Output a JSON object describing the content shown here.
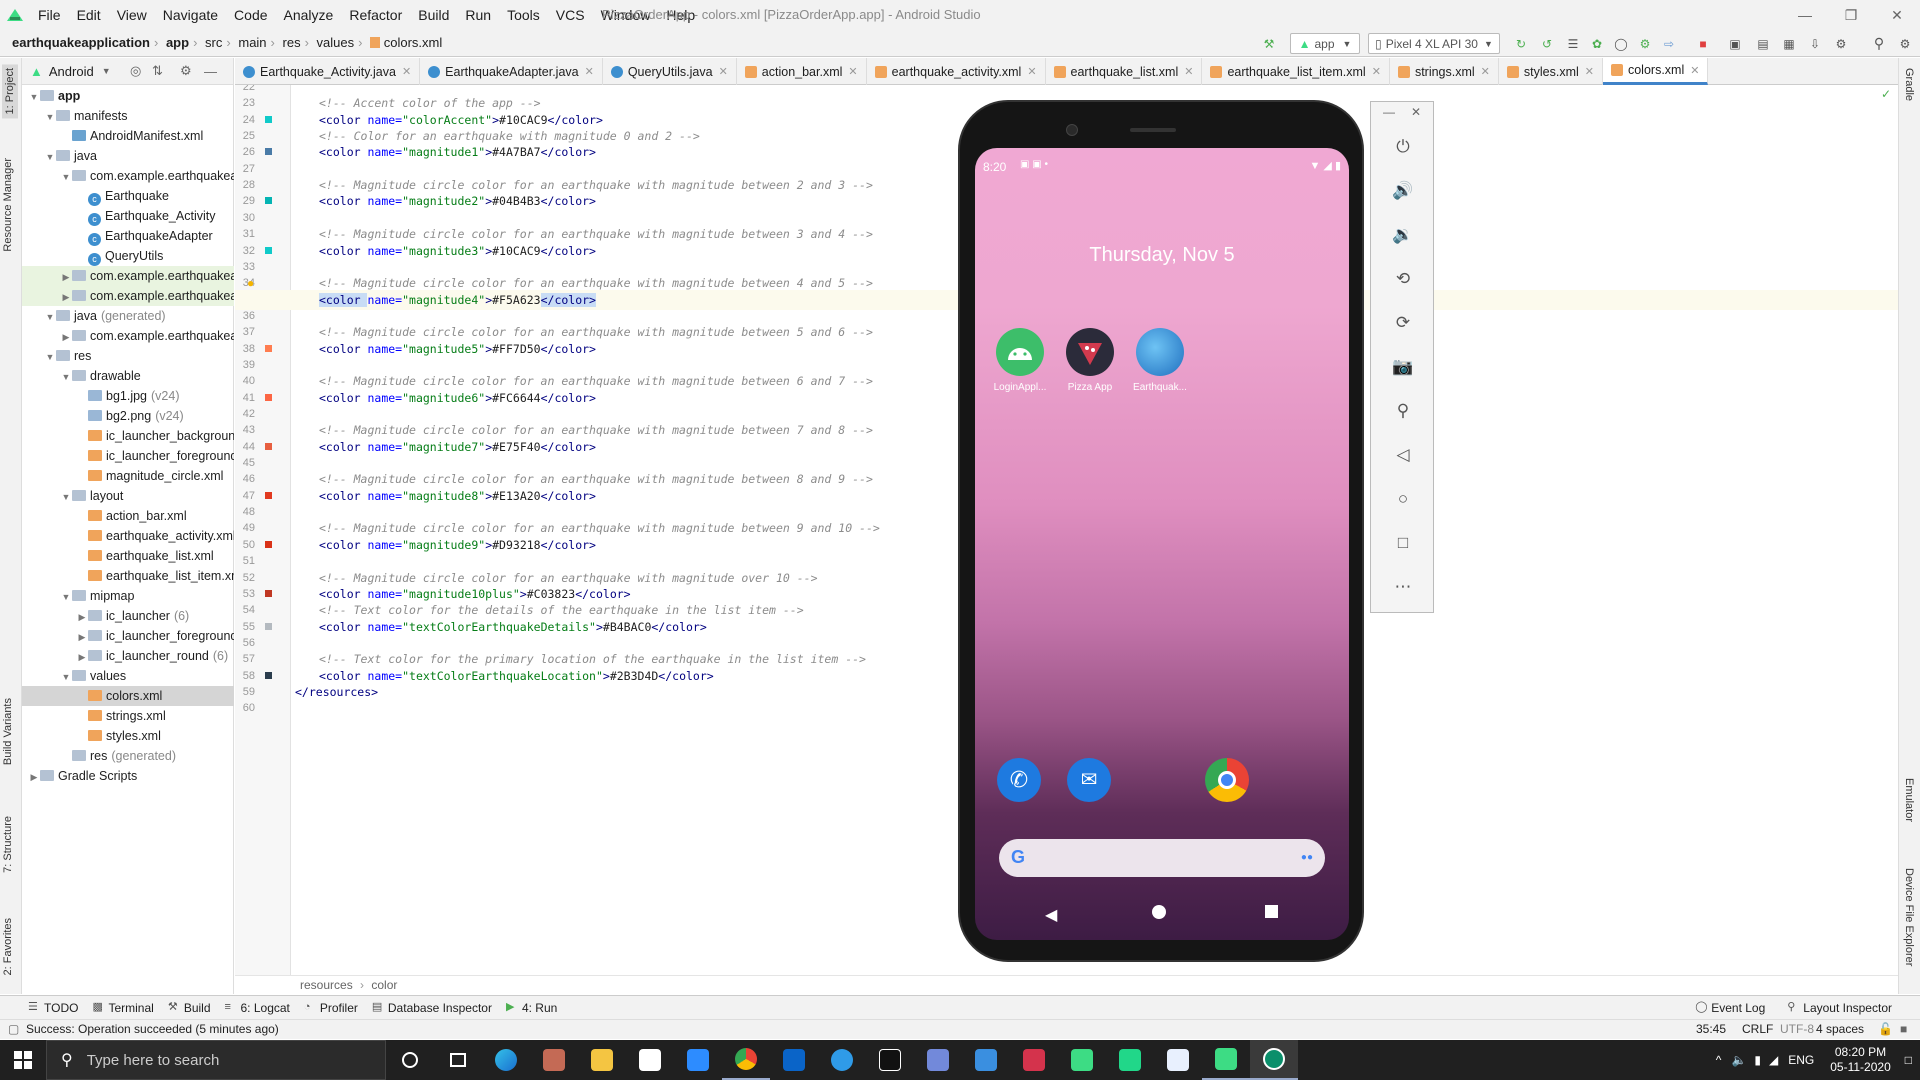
{
  "menubar": {
    "items": [
      "File",
      "Edit",
      "View",
      "Navigate",
      "Code",
      "Analyze",
      "Refactor",
      "Build",
      "Run",
      "Tools",
      "VCS",
      "Window",
      "Help"
    ],
    "window_title": "PizzaOrderApp - colors.xml [PizzaOrderApp.app] - Android Studio"
  },
  "navbar": {
    "breadcrumb": [
      "earthquakeapplication",
      "app",
      "src",
      "main",
      "res",
      "values",
      "colors.xml"
    ],
    "run_config": "app",
    "device": "Pixel 4 XL API 30"
  },
  "project": {
    "view_mode": "Android",
    "tree": [
      {
        "label": "app",
        "indent": 0,
        "arrow": "▼",
        "icon": "fold",
        "bold": true
      },
      {
        "label": "manifests",
        "indent": 1,
        "arrow": "▼",
        "icon": "fold"
      },
      {
        "label": "AndroidManifest.xml",
        "indent": 2,
        "arrow": "",
        "icon": "man"
      },
      {
        "label": "java",
        "indent": 1,
        "arrow": "▼",
        "icon": "fold"
      },
      {
        "label": "com.example.earthquakeapplication",
        "indent": 2,
        "arrow": "▼",
        "icon": "fold"
      },
      {
        "label": "Earthquake",
        "indent": 3,
        "arrow": "",
        "icon": "cls"
      },
      {
        "label": "Earthquake_Activity",
        "indent": 3,
        "arrow": "",
        "icon": "cls"
      },
      {
        "label": "EarthquakeAdapter",
        "indent": 3,
        "arrow": "",
        "icon": "cls"
      },
      {
        "label": "QueryUtils",
        "indent": 3,
        "arrow": "",
        "icon": "cls"
      },
      {
        "label": "com.example.earthquakeapplication",
        "indent": 2,
        "arrow": "▶",
        "icon": "fold",
        "hl": true
      },
      {
        "label": "com.example.earthquakeapplication",
        "indent": 2,
        "arrow": "▶",
        "icon": "fold",
        "hl": true
      },
      {
        "label": "java",
        "extra": "(generated)",
        "indent": 1,
        "arrow": "▼",
        "icon": "fold"
      },
      {
        "label": "com.example.earthquakeapplication",
        "indent": 2,
        "arrow": "▶",
        "icon": "fold"
      },
      {
        "label": "res",
        "indent": 1,
        "arrow": "▼",
        "icon": "fold"
      },
      {
        "label": "drawable",
        "indent": 2,
        "arrow": "▼",
        "icon": "fold"
      },
      {
        "label": "bg1.jpg",
        "extra": "(v24)",
        "indent": 3,
        "arrow": "",
        "icon": "img"
      },
      {
        "label": "bg2.png",
        "extra": "(v24)",
        "indent": 3,
        "arrow": "",
        "icon": "img"
      },
      {
        "label": "ic_launcher_background.xml",
        "indent": 3,
        "arrow": "",
        "icon": "xml"
      },
      {
        "label": "ic_launcher_foreground.xml",
        "indent": 3,
        "arrow": "",
        "icon": "xml"
      },
      {
        "label": "magnitude_circle.xml",
        "indent": 3,
        "arrow": "",
        "icon": "xml"
      },
      {
        "label": "layout",
        "indent": 2,
        "arrow": "▼",
        "icon": "fold"
      },
      {
        "label": "action_bar.xml",
        "indent": 3,
        "arrow": "",
        "icon": "xml"
      },
      {
        "label": "earthquake_activity.xml",
        "indent": 3,
        "arrow": "",
        "icon": "xml"
      },
      {
        "label": "earthquake_list.xml",
        "indent": 3,
        "arrow": "",
        "icon": "xml"
      },
      {
        "label": "earthquake_list_item.xml",
        "indent": 3,
        "arrow": "",
        "icon": "xml"
      },
      {
        "label": "mipmap",
        "indent": 2,
        "arrow": "▼",
        "icon": "fold"
      },
      {
        "label": "ic_launcher",
        "extra": "(6)",
        "indent": 3,
        "arrow": "▶",
        "icon": "fold"
      },
      {
        "label": "ic_launcher_foreground",
        "extra": "(6)",
        "indent": 3,
        "arrow": "▶",
        "icon": "fold"
      },
      {
        "label": "ic_launcher_round",
        "extra": "(6)",
        "indent": 3,
        "arrow": "▶",
        "icon": "fold"
      },
      {
        "label": "values",
        "indent": 2,
        "arrow": "▼",
        "icon": "fold"
      },
      {
        "label": "colors.xml",
        "indent": 3,
        "arrow": "",
        "icon": "xml",
        "selected": true
      },
      {
        "label": "strings.xml",
        "indent": 3,
        "arrow": "",
        "icon": "xml"
      },
      {
        "label": "styles.xml",
        "indent": 3,
        "arrow": "",
        "icon": "xml"
      },
      {
        "label": "res",
        "extra": "(generated)",
        "indent": 2,
        "arrow": "",
        "icon": "fold"
      },
      {
        "label": "Gradle Scripts",
        "indent": 0,
        "arrow": "▶",
        "icon": "fold"
      }
    ]
  },
  "tabs": [
    {
      "label": "Earthquake_Activity.java",
      "icon": "cls"
    },
    {
      "label": "EarthquakeAdapter.java",
      "icon": "cls"
    },
    {
      "label": "QueryUtils.java",
      "icon": "cls"
    },
    {
      "label": "action_bar.xml",
      "icon": "xml"
    },
    {
      "label": "earthquake_activity.xml",
      "icon": "xml"
    },
    {
      "label": "earthquake_list.xml",
      "icon": "xml"
    },
    {
      "label": "earthquake_list_item.xml",
      "icon": "xml"
    },
    {
      "label": "strings.xml",
      "icon": "xml"
    },
    {
      "label": "styles.xml",
      "icon": "xml"
    },
    {
      "label": "colors.xml",
      "icon": "xml",
      "active": true
    }
  ],
  "editor": {
    "lines": [
      {
        "n": 22,
        "parts": []
      },
      {
        "n": 23,
        "parts": [
          [
            "cm",
            "<!-- Accent color of the app -->"
          ]
        ]
      },
      {
        "n": 24,
        "swatch": "#10CAC9",
        "parts": [
          [
            "tg",
            "<color "
          ],
          [
            "an",
            "name="
          ],
          [
            "av",
            "\"colorAccent\""
          ],
          [
            "tg",
            ">"
          ],
          [
            "tx",
            "#10CAC9"
          ],
          [
            "tg",
            "</color>"
          ]
        ]
      },
      {
        "n": 25,
        "parts": [
          [
            "cm",
            "<!-- Color for an earthquake with magnitude 0 and 2 -->"
          ]
        ]
      },
      {
        "n": 26,
        "swatch": "#4A7BA7",
        "parts": [
          [
            "tg",
            "<color "
          ],
          [
            "an",
            "name="
          ],
          [
            "av",
            "\"magnitude1\""
          ],
          [
            "tg",
            ">"
          ],
          [
            "tx",
            "#4A7BA7"
          ],
          [
            "tg",
            "</color>"
          ]
        ]
      },
      {
        "n": 27,
        "parts": []
      },
      {
        "n": 28,
        "parts": [
          [
            "cm",
            "<!-- Magnitude circle color for an earthquake with magnitude between 2 and 3 -->"
          ]
        ]
      },
      {
        "n": 29,
        "swatch": "#04B4B3",
        "parts": [
          [
            "tg",
            "<color "
          ],
          [
            "an",
            "name="
          ],
          [
            "av",
            "\"magnitude2\""
          ],
          [
            "tg",
            ">"
          ],
          [
            "tx",
            "#04B4B3"
          ],
          [
            "tg",
            "</color>"
          ]
        ]
      },
      {
        "n": 30,
        "parts": []
      },
      {
        "n": 31,
        "parts": [
          [
            "cm",
            "<!-- Magnitude circle color for an earthquake with magnitude between 3 and 4 -->"
          ]
        ]
      },
      {
        "n": 32,
        "swatch": "#10CAC9",
        "parts": [
          [
            "tg",
            "<color "
          ],
          [
            "an",
            "name="
          ],
          [
            "av",
            "\"magnitude3\""
          ],
          [
            "tg",
            ">"
          ],
          [
            "tx",
            "#10CAC9"
          ],
          [
            "tg",
            "</color>"
          ]
        ]
      },
      {
        "n": 33,
        "parts": []
      },
      {
        "n": 34,
        "bulb": true,
        "parts": [
          [
            "cm",
            "<!-- Magnitude circle color for an earthquake with magnitude between 4 and 5 -->"
          ]
        ]
      },
      {
        "n": 35,
        "swatch": "#F5A623",
        "current": true,
        "parts": [
          [
            "tg",
            "<color "
          ],
          [
            "an",
            "name="
          ],
          [
            "av",
            "\"magnitude4\""
          ],
          [
            "tg",
            ">"
          ],
          [
            "tx",
            "#F5A623"
          ],
          [
            "tg",
            "</color>"
          ]
        ]
      },
      {
        "n": 36,
        "parts": []
      },
      {
        "n": 37,
        "parts": [
          [
            "cm",
            "<!-- Magnitude circle color for an earthquake with magnitude between 5 and 6 -->"
          ]
        ]
      },
      {
        "n": 38,
        "swatch": "#FF7D50",
        "parts": [
          [
            "tg",
            "<color "
          ],
          [
            "an",
            "name="
          ],
          [
            "av",
            "\"magnitude5\""
          ],
          [
            "tg",
            ">"
          ],
          [
            "tx",
            "#FF7D50"
          ],
          [
            "tg",
            "</color>"
          ]
        ]
      },
      {
        "n": 39,
        "parts": []
      },
      {
        "n": 40,
        "parts": [
          [
            "cm",
            "<!-- Magnitude circle color for an earthquake with magnitude between 6 and 7 -->"
          ]
        ]
      },
      {
        "n": 41,
        "swatch": "#FC6644",
        "parts": [
          [
            "tg",
            "<color "
          ],
          [
            "an",
            "name="
          ],
          [
            "av",
            "\"magnitude6\""
          ],
          [
            "tg",
            ">"
          ],
          [
            "tx",
            "#FC6644"
          ],
          [
            "tg",
            "</color>"
          ]
        ]
      },
      {
        "n": 42,
        "parts": []
      },
      {
        "n": 43,
        "parts": [
          [
            "cm",
            "<!-- Magnitude circle color for an earthquake with magnitude between 7 and 8 -->"
          ]
        ]
      },
      {
        "n": 44,
        "swatch": "#E75F40",
        "parts": [
          [
            "tg",
            "<color "
          ],
          [
            "an",
            "name="
          ],
          [
            "av",
            "\"magnitude7\""
          ],
          [
            "tg",
            ">"
          ],
          [
            "tx",
            "#E75F40"
          ],
          [
            "tg",
            "</color>"
          ]
        ]
      },
      {
        "n": 45,
        "parts": []
      },
      {
        "n": 46,
        "parts": [
          [
            "cm",
            "<!-- Magnitude circle color for an earthquake with magnitude between 8 and 9 -->"
          ]
        ]
      },
      {
        "n": 47,
        "swatch": "#E13A20",
        "parts": [
          [
            "tg",
            "<color "
          ],
          [
            "an",
            "name="
          ],
          [
            "av",
            "\"magnitude8\""
          ],
          [
            "tg",
            ">"
          ],
          [
            "tx",
            "#E13A20"
          ],
          [
            "tg",
            "</color>"
          ]
        ]
      },
      {
        "n": 48,
        "parts": []
      },
      {
        "n": 49,
        "parts": [
          [
            "cm",
            "<!-- Magnitude circle color for an earthquake with magnitude between 9 and 10 -->"
          ]
        ]
      },
      {
        "n": 50,
        "swatch": "#D93218",
        "parts": [
          [
            "tg",
            "<color "
          ],
          [
            "an",
            "name="
          ],
          [
            "av",
            "\"magnitude9\""
          ],
          [
            "tg",
            ">"
          ],
          [
            "tx",
            "#D93218"
          ],
          [
            "tg",
            "</color>"
          ]
        ]
      },
      {
        "n": 51,
        "parts": []
      },
      {
        "n": 52,
        "parts": [
          [
            "cm",
            "<!-- Magnitude circle color for an earthquake with magnitude over 10 -->"
          ]
        ]
      },
      {
        "n": 53,
        "swatch": "#C03823",
        "parts": [
          [
            "tg",
            "<color "
          ],
          [
            "an",
            "name="
          ],
          [
            "av",
            "\"magnitude10plus\""
          ],
          [
            "tg",
            ">"
          ],
          [
            "tx",
            "#C03823"
          ],
          [
            "tg",
            "</color>"
          ]
        ]
      },
      {
        "n": 54,
        "parts": [
          [
            "cm",
            "<!-- Text color for the details of the earthquake in the list item -->"
          ]
        ]
      },
      {
        "n": 55,
        "swatch": "#B4BAC0",
        "parts": [
          [
            "tg",
            "<color "
          ],
          [
            "an",
            "name="
          ],
          [
            "av",
            "\"textColorEarthquakeDetails\""
          ],
          [
            "tg",
            ">"
          ],
          [
            "tx",
            "#B4BAC0"
          ],
          [
            "tg",
            "</color>"
          ]
        ]
      },
      {
        "n": 56,
        "parts": []
      },
      {
        "n": 57,
        "parts": [
          [
            "cm",
            "<!-- Text color for the primary location of the earthquake in the list item -->"
          ]
        ]
      },
      {
        "n": 58,
        "swatch": "#2B3D4D",
        "parts": [
          [
            "tg",
            "<color "
          ],
          [
            "an",
            "name="
          ],
          [
            "av",
            "\"textColorEarthquakeLocation\""
          ],
          [
            "tg",
            ">"
          ],
          [
            "tx",
            "#2B3D4D"
          ],
          [
            "tg",
            "</color>"
          ]
        ]
      },
      {
        "n": 59,
        "parts": [
          [
            "tg",
            "</resources>"
          ]
        ],
        "outdent": true
      },
      {
        "n": 60,
        "parts": []
      }
    ]
  },
  "breadcrumb_bottom": [
    "resources",
    "color"
  ],
  "toolwindows": [
    "TODO",
    "Terminal",
    "Build",
    "6: Logcat",
    "Profiler",
    "Database Inspector",
    "4: Run"
  ],
  "toolwindows_right": [
    "Event Log",
    "Layout Inspector"
  ],
  "status": {
    "message": "Success: Operation succeeded (5 minutes ago)",
    "position": "35:45",
    "line_sep": "CRLF",
    "encoding": "UTF-8",
    "indent": "4 spaces"
  },
  "side_labels": {
    "left": [
      "1: Project",
      "Resource Manager",
      "Build Variants",
      "7: Structure",
      "2: Favorites"
    ],
    "right": [
      "Gradle",
      "Emulator",
      "Device File Explorer"
    ]
  },
  "phone": {
    "time": "8:20",
    "date": "Thursday, Nov 5",
    "apps": [
      {
        "label": "LoginAppl...",
        "color": "#3dbe6a"
      },
      {
        "label": "Pizza App",
        "color": "#d33a4e"
      },
      {
        "label": "Earthquak...",
        "color": "#3b8fd9"
      }
    ],
    "dock": [
      "phone-icon",
      "messages-icon",
      "chrome-icon"
    ]
  },
  "emulator_controls": [
    "power-icon",
    "volume-up-icon",
    "volume-down-icon",
    "rotate-left-icon",
    "rotate-right-icon",
    "camera-icon",
    "zoom-icon",
    "back-icon",
    "home-icon",
    "overview-icon",
    "more-icon"
  ],
  "taskbar": {
    "search_placeholder": "Type here to search",
    "lang": "ENG",
    "time": "08:20 PM",
    "date": "05-11-2020"
  }
}
